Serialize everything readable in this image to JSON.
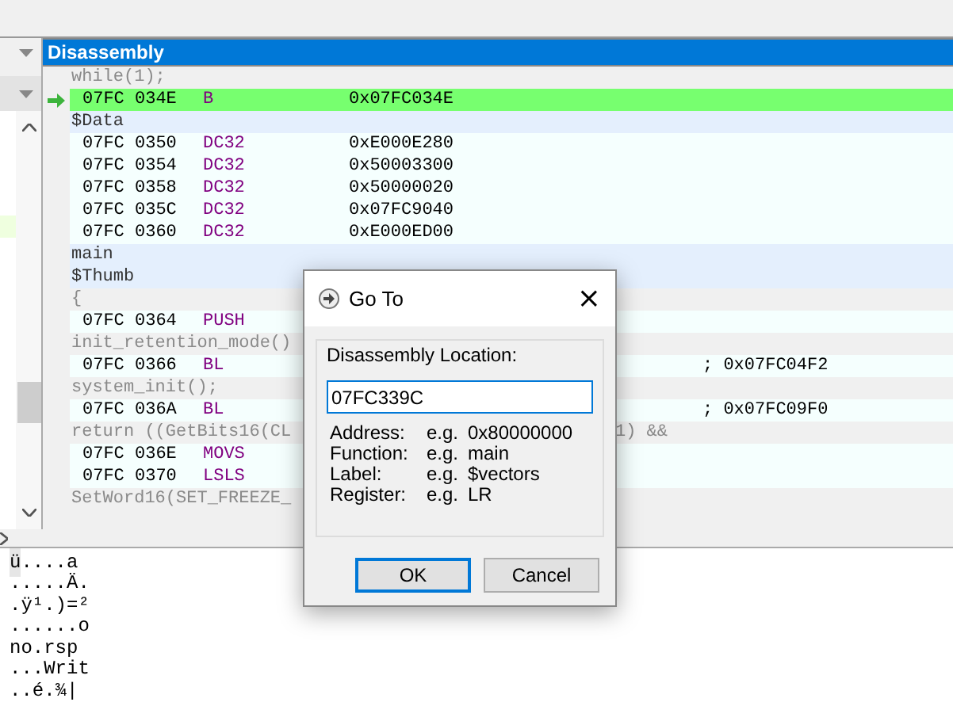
{
  "disassembly": {
    "title": "Disassembly",
    "lines": [
      {
        "kind": "source",
        "text": "while(1);"
      },
      {
        "kind": "current",
        "address": "07FC 034E",
        "mnemonic": "B",
        "operand": "0x07FC034E"
      },
      {
        "kind": "label",
        "text": "$Data"
      },
      {
        "kind": "instruction",
        "address": "07FC 0350",
        "mnemonic": "DC32",
        "operand": "0xE000E280"
      },
      {
        "kind": "instruction",
        "address": "07FC 0354",
        "mnemonic": "DC32",
        "operand": "0x50003300"
      },
      {
        "kind": "instruction",
        "address": "07FC 0358",
        "mnemonic": "DC32",
        "operand": "0x50000020"
      },
      {
        "kind": "instruction",
        "address": "07FC 035C",
        "mnemonic": "DC32",
        "operand": "0x07FC9040"
      },
      {
        "kind": "instruction",
        "address": "07FC 0360",
        "mnemonic": "DC32",
        "operand": "0xE000ED00"
      },
      {
        "kind": "label",
        "text": "main"
      },
      {
        "kind": "label",
        "text": "$Thumb"
      },
      {
        "kind": "source",
        "text": "{"
      },
      {
        "kind": "instruction",
        "address": "07FC 0364",
        "mnemonic": "PUSH"
      },
      {
        "kind": "source",
        "text": "init_retention_mode()"
      },
      {
        "kind": "instruction",
        "address": "07FC 0366",
        "mnemonic": "BL",
        "comment": "; 0x07FC04F2"
      },
      {
        "kind": "source",
        "text": "system_init();"
      },
      {
        "kind": "instruction",
        "address": "07FC 036A",
        "mnemonic": "BL",
        "comment": "; 0x07FC09F0"
      },
      {
        "kind": "source",
        "text": "return ((GetBits16(CL",
        "tail": "1) &&"
      },
      {
        "kind": "instruction",
        "address": "07FC 036E",
        "mnemonic": "MOVS"
      },
      {
        "kind": "instruction",
        "address": "07FC 0370",
        "mnemonic": "LSLS"
      },
      {
        "kind": "source",
        "text": "SetWord16(SET_FREEZE_"
      }
    ]
  },
  "memory": {
    "lines": [
      {
        "selection": "ü",
        "text": "....a"
      },
      {
        "text": ".....Ä."
      },
      {
        "text": ".ÿ¹.)=²"
      },
      {
        "text": "......o"
      },
      {
        "text": "no.rsp"
      },
      {
        "text": "...Writ"
      },
      {
        "text": "..é.¾|"
      }
    ]
  },
  "dialog": {
    "title": "Go To",
    "close": "×",
    "group_label": "Disassembly Location:",
    "value": "07FC339C",
    "examples": [
      {
        "label": "Address:",
        "eg": "e.g.",
        "value": "0x80000000"
      },
      {
        "label": "Function:",
        "eg": "e.g.",
        "value": "main"
      },
      {
        "label": "Label:",
        "eg": "e.g.",
        "value": "$vectors"
      },
      {
        "label": "Register:",
        "eg": "e.g.",
        "value": "LR"
      }
    ],
    "buttons": [
      {
        "label": "OK",
        "default": true
      },
      {
        "label": "Cancel",
        "default": false
      }
    ]
  }
}
